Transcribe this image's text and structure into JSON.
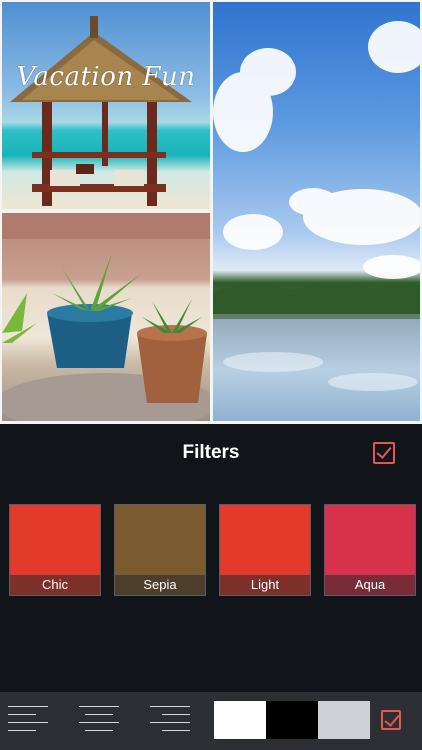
{
  "collage": {
    "caption": "Vacation Fun"
  },
  "filters_panel": {
    "title": "Filters",
    "confirm_icon": "checkbox-check-icon",
    "accent_color": "#e4584f",
    "items": [
      {
        "label": "Chic",
        "thumb": "umbrella-vivid"
      },
      {
        "label": "Sepia",
        "thumb": "umbrella-sepia"
      },
      {
        "label": "Light",
        "thumb": "umbrella-vivid"
      },
      {
        "label": "Aqua",
        "thumb": "umbrella-aqua"
      }
    ]
  },
  "toolbar": {
    "align_buttons": [
      "align-left-icon",
      "align-center-icon",
      "align-right-icon"
    ],
    "swatches": [
      "#ffffff",
      "#000000",
      "#cfd1d6"
    ],
    "confirm_icon": "checkbox-check-icon"
  }
}
